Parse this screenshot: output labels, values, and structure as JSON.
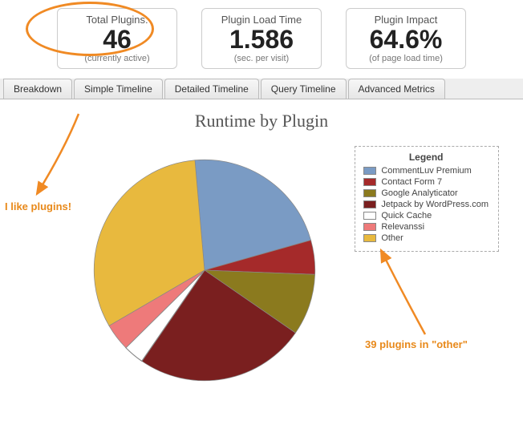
{
  "stats": [
    {
      "label": "Total Plugins:",
      "value": "46",
      "sub": "(currently active)"
    },
    {
      "label": "Plugin Load Time",
      "value": "1.586",
      "sub": "(sec. per visit)"
    },
    {
      "label": "Plugin Impact",
      "value": "64.6%",
      "sub": "(of page load time)"
    }
  ],
  "tabs": [
    "Breakdown",
    "Simple Timeline",
    "Detailed Timeline",
    "Query Timeline",
    "Advanced Metrics"
  ],
  "chart_title": "Runtime by Plugin",
  "legend_title": "Legend",
  "annotations": {
    "like_plugins": "I like plugins!",
    "other_note": "39 plugins in \"other\""
  },
  "chart_data": {
    "type": "pie",
    "title": "Runtime by Plugin",
    "series": [
      {
        "name": "CommentLuv Premium",
        "value": 22,
        "color": "#7a9bc4"
      },
      {
        "name": "Contact Form 7",
        "value": 5,
        "color": "#a52a2a"
      },
      {
        "name": "Google Analyticator",
        "value": 9,
        "color": "#8b7a1e"
      },
      {
        "name": "Jetpack by WordPress.com",
        "value": 25,
        "color": "#7a1f1f"
      },
      {
        "name": "Quick Cache",
        "value": 3,
        "color": "#ffffff"
      },
      {
        "name": "Relevanssi",
        "value": 4,
        "color": "#ee7a7a"
      },
      {
        "name": "Other",
        "value": 32,
        "color": "#e8b93e"
      }
    ]
  }
}
